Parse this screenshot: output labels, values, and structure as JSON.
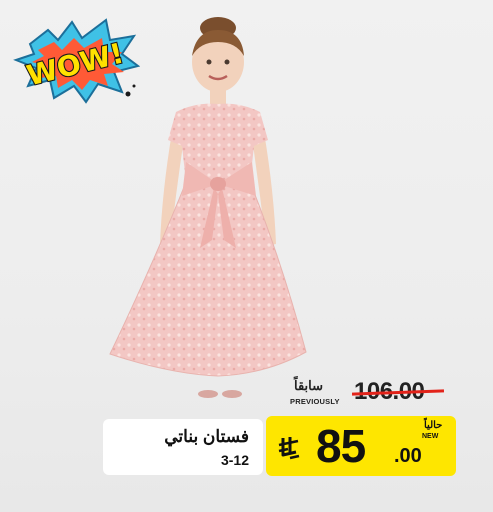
{
  "badge": {
    "text": "WOW!",
    "icon": "wow-burst-icon"
  },
  "product": {
    "icon": "girl-dress-photo"
  },
  "previous": {
    "label_ar": "سابقاً",
    "label_en": "PREVIOUSLY",
    "price": "106.00"
  },
  "name": {
    "title_ar": "فستان بناتي",
    "size": "3-12"
  },
  "current": {
    "label_ar": "حالياً",
    "label_en": "NEW",
    "price_int": "85",
    "price_dec": ".00",
    "currency_icon": "saudi-riyal-icon"
  },
  "colors": {
    "price_bg": "#fee600",
    "strike": "#e2231a",
    "dress": "#f3c7c4"
  }
}
